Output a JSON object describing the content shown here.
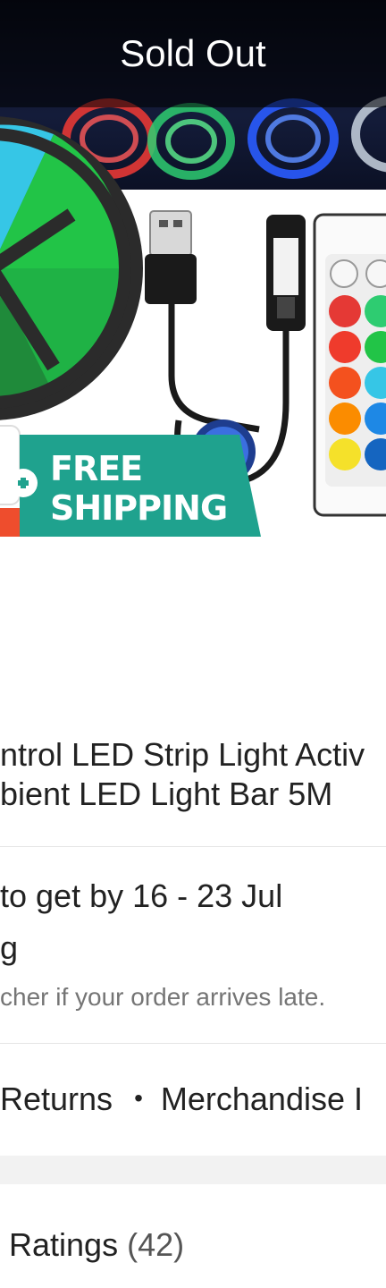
{
  "product_image": {
    "sold_out_label": "Sold Out",
    "free_shipping_label": "FREE\nSHIPPING",
    "colors": {
      "free_shipping_teal": "#1fa28e",
      "strip_green": "#22c447",
      "strip_cyan": "#36c6e6",
      "remote_red": "#e53935",
      "remote_yellow": "#f5e12a"
    }
  },
  "title": {
    "line1": "ntrol LED Strip Light Activ",
    "line2": "bient LED Light Bar 5M"
  },
  "shipping": {
    "eta": "to get by 16 - 23 Jul",
    "label_fragment": "g",
    "guarantee": "cher if your order arrives late."
  },
  "services": {
    "returns": "Returns",
    "separator": "•",
    "merchandise": "Merchandise I"
  },
  "ratings": {
    "label": "Ratings",
    "count": "(42)"
  }
}
